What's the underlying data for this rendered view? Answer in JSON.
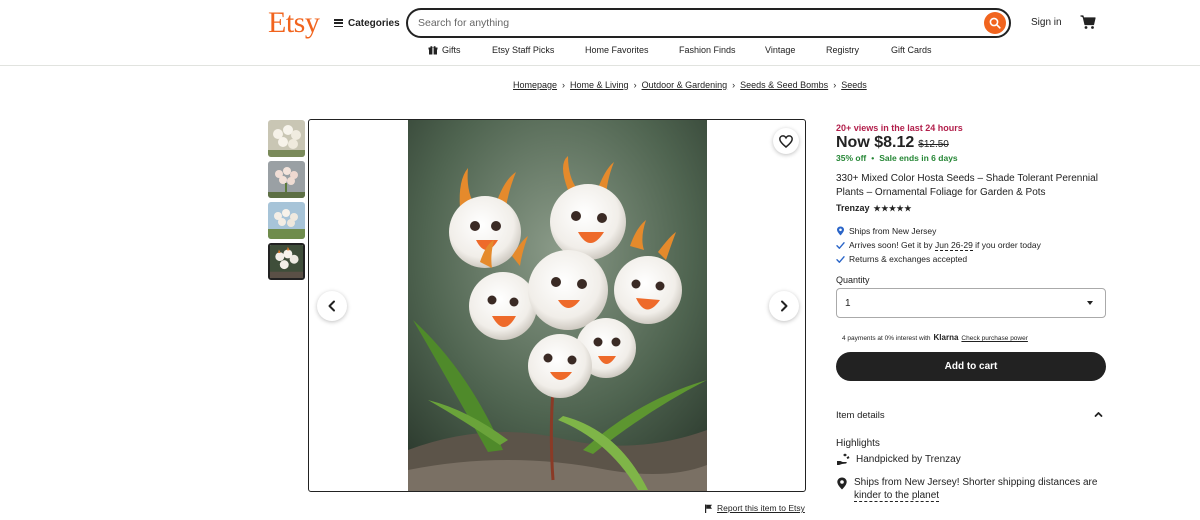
{
  "header": {
    "logo": "Etsy",
    "categories_label": "Categories",
    "search_placeholder": "Search for anything",
    "signin_label": "Sign in"
  },
  "nav": {
    "items": [
      "Gifts",
      "Etsy Staff Picks",
      "Home Favorites",
      "Fashion Finds",
      "Vintage",
      "Registry",
      "Gift Cards"
    ]
  },
  "breadcrumb": [
    "Homepage",
    "Home & Living",
    "Outdoor & Gardening",
    "Seeds & Seed Bombs",
    "Seeds"
  ],
  "gallery": {
    "thumbnail_count": 4,
    "active_index": 3,
    "report_label": "Report this item to Etsy"
  },
  "product": {
    "views": "20+ views in the last 24 hours",
    "price_now": "Now $8.12",
    "price_was": "$12.50",
    "discount": "35% off",
    "sale_ends": "Sale ends in 6 days",
    "title": "330+ Mixed Color Hosta Seeds – Shade Tolerant Perennial Plants – Ornamental Foliage for Garden & Pots",
    "shop_name": "Trenzay",
    "stars": "★★★★★",
    "ships_from": "Ships from New Jersey",
    "arrives_prefix": "Arrives soon! Get it by ",
    "arrives_date": "Jun 26-29",
    "arrives_suffix": " if you order today",
    "returns": "Returns & exchanges accepted",
    "quantity_label": "Quantity",
    "quantity_value": "1",
    "klarna_prefix": "4 payments at 0% interest with",
    "klarna_brand": "Klarna",
    "klarna_link": "Check purchase power",
    "add_to_cart": "Add to cart",
    "item_details": "Item details",
    "highlights": "Highlights",
    "handpicked_prefix": "Handpicked by ",
    "handpicked_shop": "Trenzay",
    "ships_note_prefix": "Ships from New Jersey! Shorter shipping distances are ",
    "ships_note_link": "kinder to the planet"
  },
  "colors": {
    "brand": "#f1641e",
    "views": "#b21f4b",
    "sale": "#258635",
    "dark": "#222222"
  }
}
